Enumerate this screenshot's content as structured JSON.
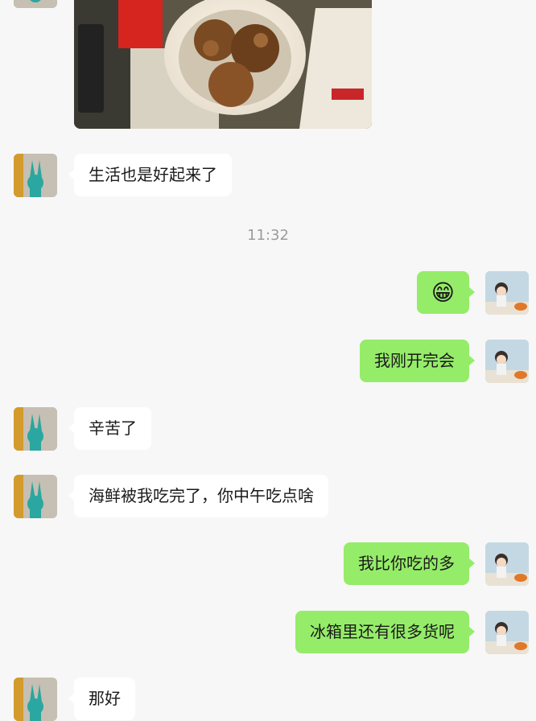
{
  "conversation": {
    "timestamp": "11:32",
    "messages": [
      {
        "from": "friend",
        "text": "生活也是好起来了"
      },
      {
        "from": "me",
        "emoji": "😁"
      },
      {
        "from": "me",
        "text": "我刚开完会"
      },
      {
        "from": "friend",
        "text": "辛苦了"
      },
      {
        "from": "friend",
        "text": "海鲜被我吃完了，你中午吃点啥"
      },
      {
        "from": "me",
        "text": "我比你吃的多"
      },
      {
        "from": "me",
        "text": "冰箱里还有很多货呢"
      },
      {
        "from": "friend",
        "text": "那好"
      }
    ]
  },
  "colors": {
    "background": "#f7f7f7",
    "incoming_bubble": "#ffffff",
    "outgoing_bubble": "#95ec69",
    "timestamp_text": "#9b9b9b"
  },
  "icons": {
    "friend_avatar": "rabbit-figure-avatar",
    "my_avatar": "illustrated-girl-avatar",
    "emoji": "grinning-face-emoji"
  }
}
